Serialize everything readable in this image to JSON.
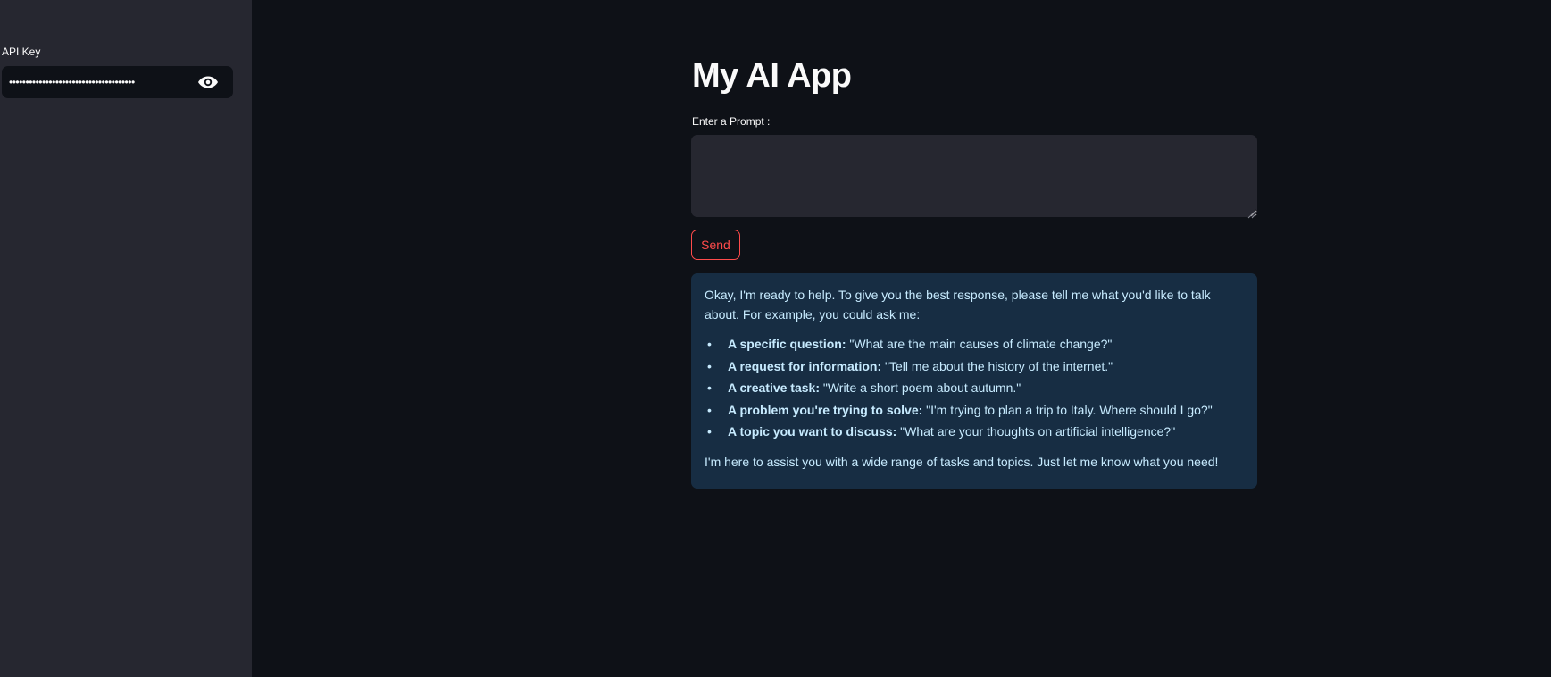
{
  "sidebar": {
    "api_key_label": "API Key",
    "api_key_value": "••••••••••••••••••••••••••••••••••••••",
    "reveal_icon": "eye-icon"
  },
  "main": {
    "title": "My AI App",
    "prompt_label": "Enter a Prompt :",
    "prompt_value": "",
    "send_label": "Send"
  },
  "response": {
    "intro": "Okay, I'm ready to help. To give you the best response, please tell me what you'd like to talk about. For example, you could ask me:",
    "items": [
      {
        "bullet": "•",
        "label": "A specific question:",
        "text": " \"What are the main causes of climate change?\""
      },
      {
        "bullet": "•",
        "label": "A request for information:",
        "text": " \"Tell me about the history of the internet.\""
      },
      {
        "bullet": "•",
        "label": "A creative task:",
        "text": " \"Write a short poem about autumn.\""
      },
      {
        "bullet": "•",
        "label": "A problem you're trying to solve:",
        "text": " \"I'm trying to plan a trip to Italy. Where should I go?\""
      },
      {
        "bullet": "•",
        "label": "A topic you want to discuss:",
        "text": " \"What are your thoughts on artificial intelligence?\""
      }
    ],
    "outro": "I'm here to assist you with a wide range of tasks and topics. Just let me know what you need!"
  },
  "colors": {
    "background": "#0e1117",
    "sidebar": "#262730",
    "accent": "#ff4b4b",
    "info_background": "#172d43",
    "info_text": "#c7ebff"
  }
}
